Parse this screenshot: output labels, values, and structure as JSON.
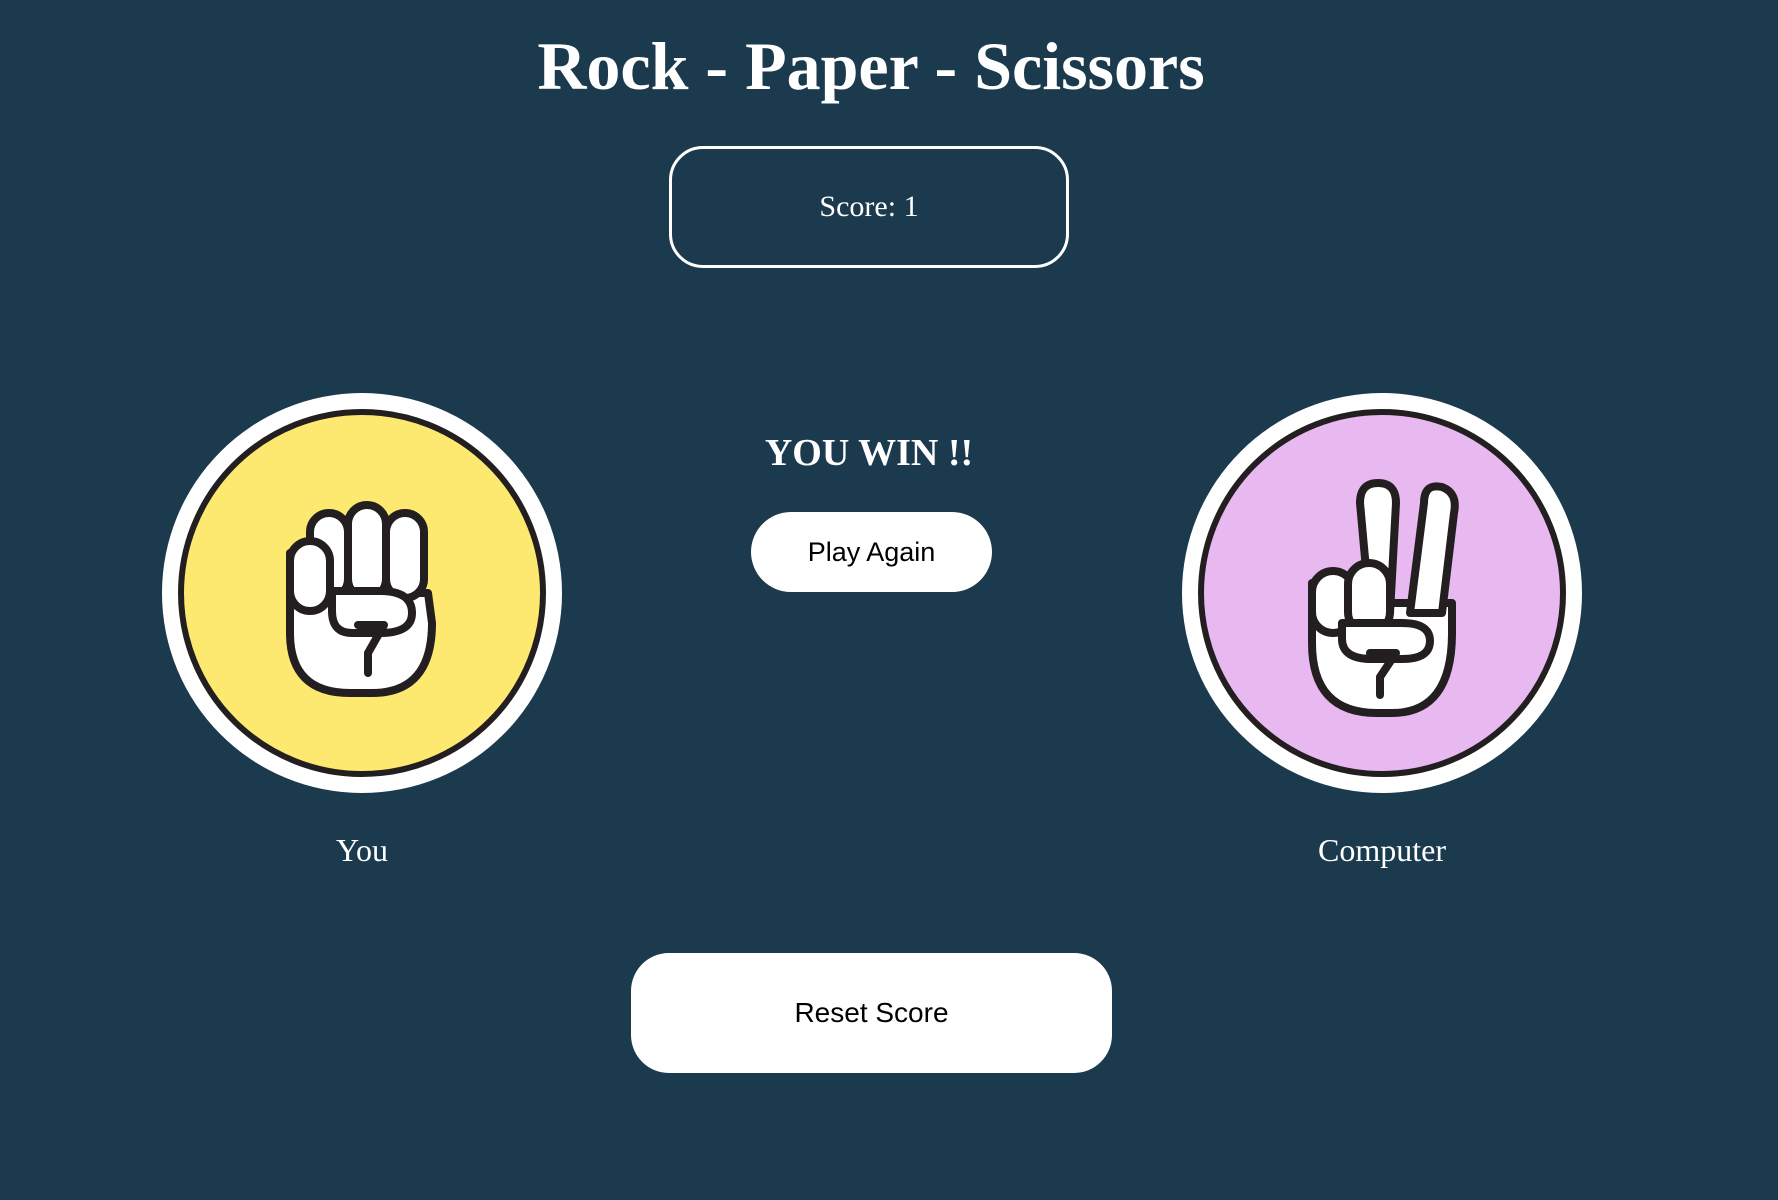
{
  "title": "Rock - Paper - Scissors",
  "score": {
    "text": "Score: 1"
  },
  "result": {
    "text": "YOU WIN !!",
    "play_again_label": "Play Again"
  },
  "player": {
    "label": "You",
    "choice_icon": "rock-fist-icon",
    "color": "#fde96f"
  },
  "computer": {
    "label": "Computer",
    "choice_icon": "scissors-peace-hand-icon",
    "color": "#e8b8f0"
  },
  "reset_label": "Reset Score",
  "colors": {
    "background": "#1c3a4e",
    "outline": "#231f20"
  }
}
